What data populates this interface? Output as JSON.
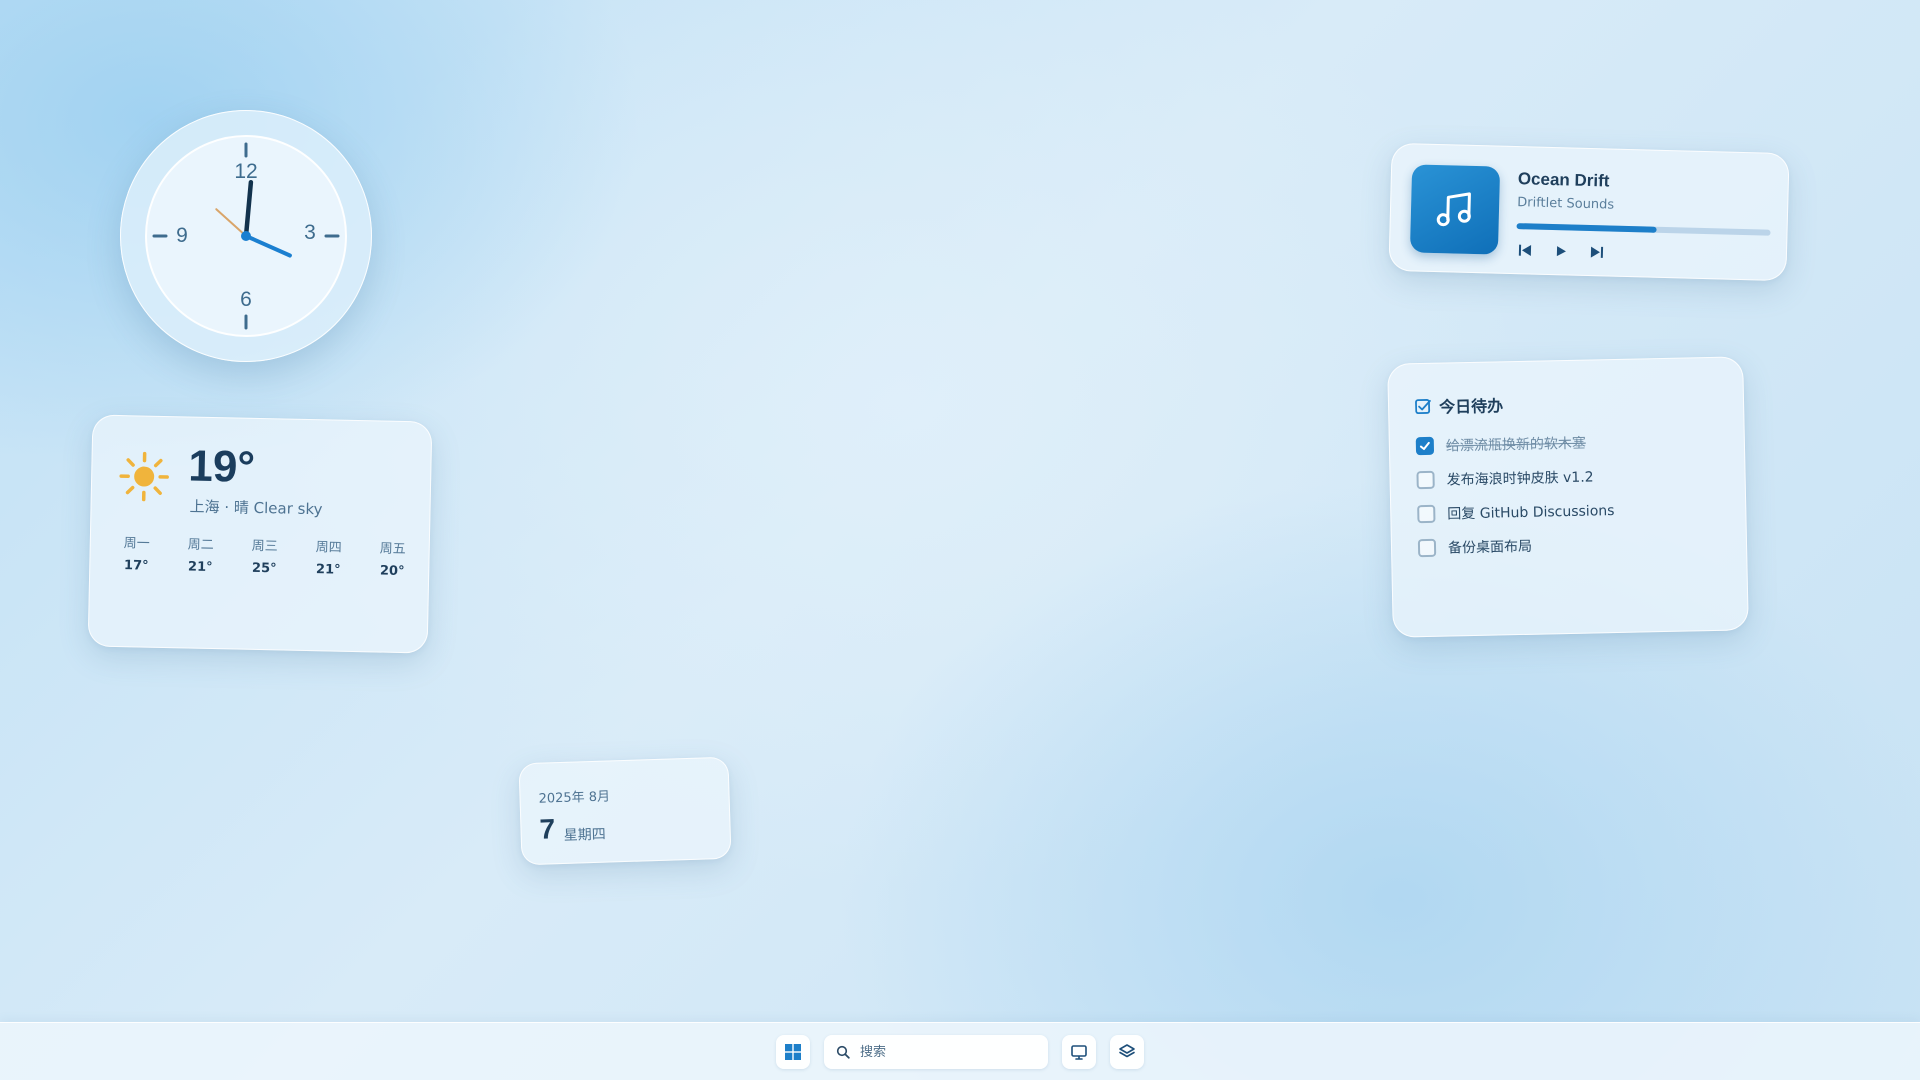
{
  "clock": {
    "numbers": {
      "n12": "12",
      "n3": "3",
      "n6": "6",
      "n9": "9"
    },
    "time": {
      "hours": 4,
      "minutes": 0,
      "seconds": 52
    }
  },
  "weather": {
    "icon": "sun-icon",
    "temperature": "19°",
    "description": "上海 · 晴 Clear sky",
    "forecast": [
      {
        "day": "周一",
        "temp": "17°"
      },
      {
        "day": "周二",
        "temp": "21°"
      },
      {
        "day": "周三",
        "temp": "25°"
      },
      {
        "day": "周四",
        "temp": "21°"
      },
      {
        "day": "周五",
        "temp": "20°"
      }
    ]
  },
  "date": {
    "year_month": "2025年 8月",
    "day": "7",
    "weekday": "星期四"
  },
  "music": {
    "title": "Ocean Drift",
    "artist": "Driftlet Sounds",
    "progress": 0.55,
    "icons": [
      "music-note-icon",
      "previous-icon",
      "play-icon",
      "next-icon"
    ]
  },
  "todo": {
    "title": "今日待办",
    "items": [
      {
        "label": "给漂流瓶换新的软木塞",
        "done": true
      },
      {
        "label": "发布海浪时钟皮肤 v1.2",
        "done": false
      },
      {
        "label": "回复 GitHub Discussions",
        "done": false
      },
      {
        "label": "备份桌面布局",
        "done": false
      }
    ]
  },
  "taskbar": {
    "search_placeholder": "搜索",
    "icons": [
      "windows-start-icon",
      "search-icon",
      "desktop-icon",
      "layers-icon"
    ]
  },
  "colors": {
    "accent": "#1d7fc9",
    "text_dark": "#1f3f5c",
    "sun": "#f0b43c",
    "second_hand": "#d9a56a"
  }
}
